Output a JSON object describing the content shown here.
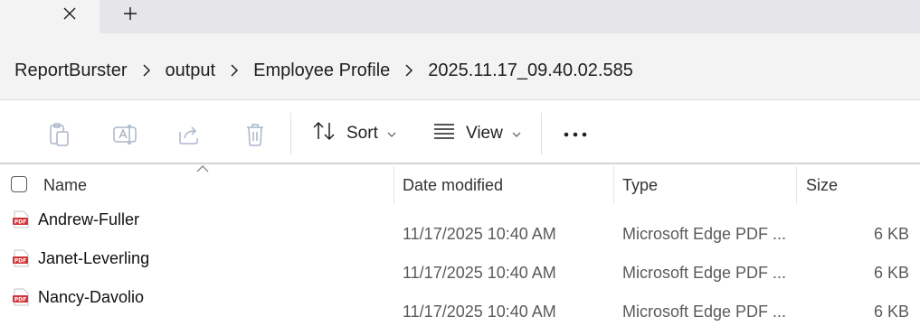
{
  "tabs": {
    "close_icon": "close-icon",
    "new_tab_icon": "plus-icon"
  },
  "breadcrumb": [
    "ReportBurster",
    "output",
    "Employee Profile",
    "2025.11.17_09.40.02.585"
  ],
  "toolbar": {
    "sort_label": "Sort",
    "view_label": "View",
    "icons": [
      "paste-icon",
      "rename-icon",
      "share-icon",
      "delete-icon",
      "sort-icon",
      "view-icon",
      "more-icon"
    ]
  },
  "columns": {
    "name": "Name",
    "date": "Date modified",
    "type": "Type",
    "size": "Size"
  },
  "files": [
    {
      "name": "Andrew-Fuller",
      "date": "11/17/2025 10:40 AM",
      "type": "Microsoft Edge PDF ...",
      "size": "6 KB"
    },
    {
      "name": "Janet-Leverling",
      "date": "11/17/2025 10:40 AM",
      "type": "Microsoft Edge PDF ...",
      "size": "6 KB"
    },
    {
      "name": "Nancy-Davolio",
      "date": "11/17/2025 10:40 AM",
      "type": "Microsoft Edge PDF ...",
      "size": "6 KB"
    }
  ],
  "colors": {
    "pdf_icon": "#d13438",
    "tab_strip": "#e6e6ea",
    "address_bg": "#f3f3f3",
    "disabled_icon": "#a9b6c9"
  }
}
